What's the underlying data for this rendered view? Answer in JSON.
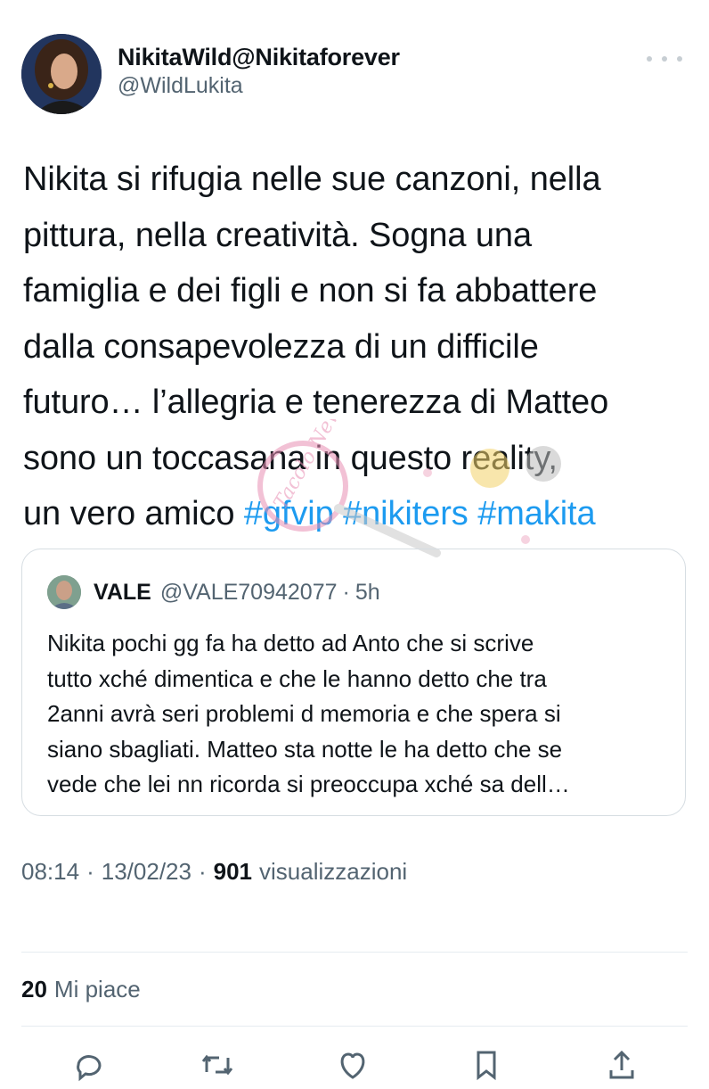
{
  "author": {
    "display_name": "NikitaWild@Nikitaforever",
    "handle": "@WildLukita"
  },
  "tweet": {
    "lines": [
      "Nikita si rifugia nelle sue canzoni, nella",
      "pittura, nella creatività. Sogna una",
      "famiglia e dei figli e non si fa abbattere",
      "dalla consapevolezza di un difficile",
      "futuro… l’allegria e tenerezza di Matteo",
      "sono un toccasana in questo reality,"
    ],
    "last_line_text": "un vero amico ",
    "hashtags": [
      "#gfvip",
      "#nikiters",
      "#makita"
    ]
  },
  "quote": {
    "name": "VALE",
    "handle": "@VALE70942077",
    "separator": "·",
    "time": "5h",
    "lines": [
      "Nikita pochi gg fa ha detto ad Anto che si scrive",
      "tutto xché dimentica e che le hanno detto che tra",
      "2anni avrà seri problemi d memoria e che spera si",
      "siano sbagliati. Matteo sta notte le ha detto che se",
      "vede che lei nn ricorda si preoccupa xché sa dell…"
    ]
  },
  "meta": {
    "time": "08:14",
    "separator": "·",
    "date": "13/02/23",
    "views_count": "901",
    "views_label": "visualizzazioni"
  },
  "likes": {
    "count": "20",
    "label": "Mi piace"
  },
  "watermark": {
    "text": "Tacolo News"
  },
  "colors": {
    "link": "#1d9bf0",
    "secondary_text": "#536471",
    "primary_text": "#0f1419",
    "border": "#d6dde2"
  },
  "icons": [
    "more-icon",
    "reply-icon",
    "retweet-icon",
    "like-icon",
    "bookmark-icon",
    "share-icon"
  ]
}
